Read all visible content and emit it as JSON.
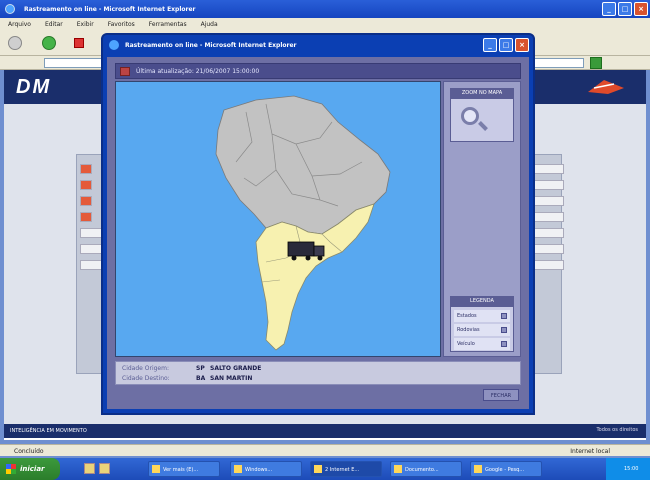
{
  "browser": {
    "title": "Rastreamento on line - Microsoft Internet Explorer",
    "menu": [
      "Arquivo",
      "Editar",
      "Exibir",
      "Favoritos",
      "Ferramentas",
      "Ajuda"
    ],
    "status_left": "Concluído",
    "status_right": "Internet local"
  },
  "site": {
    "logo": "DM",
    "footer_left": "INTELIGÊNCIA EM MOVIMENTO",
    "footer_right": "Todos os direitos"
  },
  "popup": {
    "title": "Rastreamento on line - Microsoft Internet Explorer",
    "update_text": "Última atualização: 21/06/2007 15:00:00",
    "zoom_label": "ZOOM NO MAPA",
    "legend_label": "LEGENDA",
    "legend_items": [
      "Estados",
      "Rodovias",
      "Veículo"
    ],
    "origin_label": "Cidade Origem:",
    "origin_code": "SP",
    "origin_value": "SALTO GRANDE",
    "dest_label": "Cidade Destino:",
    "dest_code": "BA",
    "dest_value": "SAN MARTIN",
    "close_label": "FECHAR"
  },
  "taskbar": {
    "start": "iniciar",
    "tasks": [
      "Ver mais (E)...",
      "Windows...",
      "2 Internet E...",
      "Documento...",
      "Google - Pesq..."
    ],
    "clock": "15:00"
  },
  "colors": {
    "ocean": "#58a8f0",
    "country_grey": "#c2c2c2",
    "country_yellow": "#f7f1b0",
    "accent_navy": "#1a2e6b"
  }
}
